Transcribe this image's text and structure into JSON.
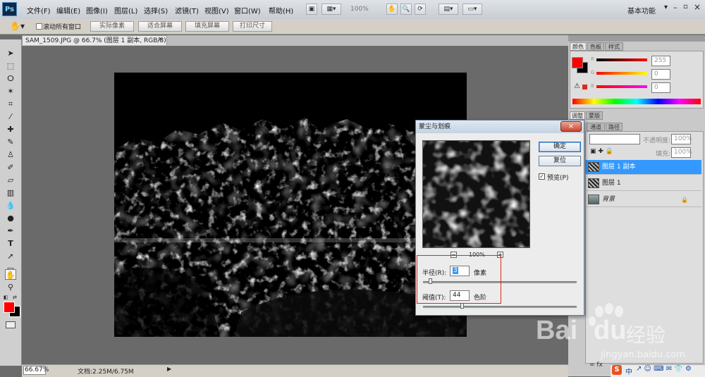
{
  "menubar": {
    "logo": "Ps",
    "menus": [
      "文件(F)",
      "编辑(E)",
      "图像(I)",
      "图层(L)",
      "选择(S)",
      "滤镜(T)",
      "视图(V)",
      "窗口(W)",
      "帮助(H)"
    ],
    "zoom_display": "100%",
    "workspace": "基本功能"
  },
  "optionsbar": {
    "scroll_all_label": "滚动所有窗口",
    "buttons": [
      "实际像素",
      "适合屏幕",
      "填充屏幕",
      "打印尺寸"
    ]
  },
  "document": {
    "tab_title": "SAM_1509.JPG @ 66.7% (图层 1 副本, RGB/8) *"
  },
  "statusbar": {
    "zoom": "66.67%",
    "doc_info": "文档:2.25M/6.75M"
  },
  "color_panel": {
    "tabs": [
      "颜色",
      "色板",
      "样式"
    ],
    "r_value": "255",
    "g_value": "0",
    "b_value": "0",
    "r_label": "R",
    "g_label": "G",
    "b_label": "B",
    "foreground": "#ff0000",
    "background": "#000000"
  },
  "adjust_panel": {
    "tabs": [
      "调整",
      "蒙版"
    ]
  },
  "layers_panel": {
    "tabs": [
      "通道",
      "路径"
    ],
    "opacity_label": "不透明度:",
    "opacity_value": "100%",
    "fill_label": "填充:",
    "fill_value": "100%",
    "layers": [
      {
        "name": "图层 1 副本",
        "selected": true
      },
      {
        "name": "图层 1",
        "selected": false
      },
      {
        "name": "背景",
        "selected": false
      }
    ]
  },
  "dialog": {
    "title": "蒙尘与划痕",
    "ok_label": "确定",
    "reset_label": "复位",
    "preview_label": "预览(P)",
    "preview_checked": true,
    "zoom_minus": "−",
    "zoom_plus": "+",
    "zoom": "100%",
    "radius_label": "半径(R):",
    "radius_value": "3",
    "radius_unit": "像素",
    "threshold_label": "阈值(T):",
    "threshold_value": "44",
    "threshold_unit": "色阶"
  },
  "watermark": {
    "brand": "Bai",
    "brand2": "du",
    "cn": "经验",
    "url": "jingyan.baidu.com"
  },
  "taskbar": {
    "ime_cn": "中",
    "ime_s": "S"
  },
  "colors": {
    "selection_blue": "#3399ff",
    "accent_red": "#e0281e"
  }
}
